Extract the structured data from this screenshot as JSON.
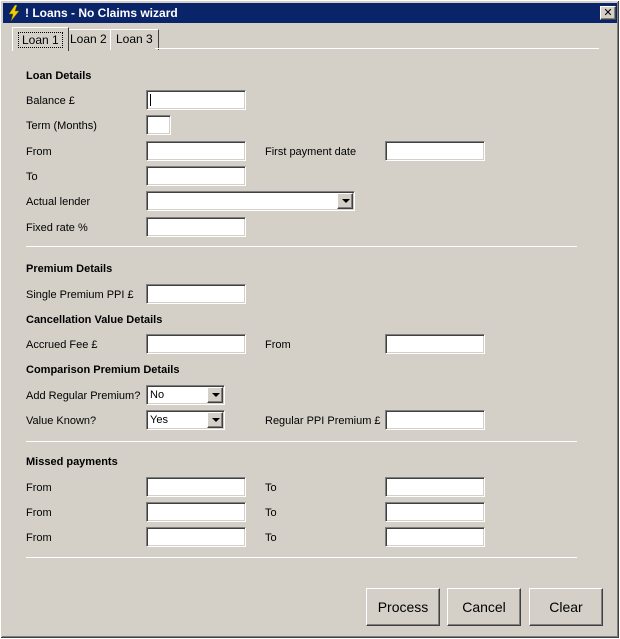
{
  "window": {
    "title": "! Loans - No Claims wizard",
    "close_glyph": "✕"
  },
  "tabs": [
    {
      "label": "Loan 1"
    },
    {
      "label": "Loan 2"
    },
    {
      "label": "Loan 3"
    }
  ],
  "loan_details": {
    "header": "Loan Details",
    "balance_label": "Balance £",
    "term_label": "Term (Months)",
    "from_label": "From",
    "first_payment_label": "First payment date",
    "to_label": "To",
    "lender_label": "Actual lender",
    "fixed_rate_label": "Fixed rate %",
    "balance_value": "",
    "term_value": "",
    "from_value": "",
    "first_payment_value": "",
    "to_value": "",
    "lender_value": "",
    "fixed_rate_value": ""
  },
  "premium_details": {
    "header": "Premium Details",
    "single_premium_label": "Single Premium PPI £",
    "single_premium_value": ""
  },
  "cancellation": {
    "header": "Cancellation Value Details",
    "accrued_fee_label": "Accrued Fee £",
    "from_label": "From",
    "accrued_fee_value": "",
    "from_value": ""
  },
  "comparison": {
    "header": "Comparison Premium Details",
    "add_regular_label": "Add Regular Premium?",
    "add_regular_value": "No",
    "value_known_label": "Value Known?",
    "value_known_value": "Yes",
    "regular_ppi_label": "Regular PPI Premium £",
    "regular_ppi_value": ""
  },
  "missed_payments": {
    "header": "Missed payments",
    "rows": [
      {
        "from_label": "From",
        "to_label": "To"
      },
      {
        "from_label": "From",
        "to_label": "To"
      },
      {
        "from_label": "From",
        "to_label": "To"
      }
    ]
  },
  "buttons": {
    "process": "Process",
    "cancel": "Cancel",
    "clear": "Clear"
  },
  "colors": {
    "titlebar": "#0a246a",
    "face": "#d4d0c8"
  }
}
